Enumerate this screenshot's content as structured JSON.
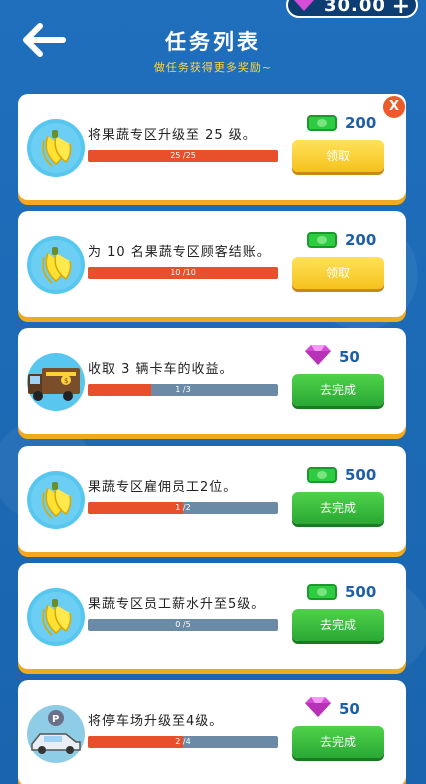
{
  "header": {
    "gem_value": "30.00",
    "plus_label": "+",
    "title": "任务列表",
    "subtitle": "做任务获得更多奖励~"
  },
  "close_label": "X",
  "colors": {
    "background": "#1a6ab8",
    "card": "#ffffff",
    "card_shadow": "#f1a91f",
    "progress_fill": "#e8502b",
    "progress_track": "#6b8aa5",
    "claim_button": "#f5c21b",
    "go_button": "#2aa834",
    "reward_text": "#1f5fa8"
  },
  "tasks": [
    {
      "icon": "banana-icon",
      "desc": "将果蔬专区升级至 25 级。",
      "progress_text": "25 /25",
      "progress": 1.0,
      "reward_icon": "cash-icon",
      "reward": "200",
      "button": "领取"
    },
    {
      "icon": "banana-icon",
      "desc": "为 10 名果蔬专区顾客结账。",
      "progress_text": "10 /10",
      "progress": 1.0,
      "reward_icon": "cash-icon",
      "reward": "200",
      "button": "领取"
    },
    {
      "icon": "truck-icon",
      "desc": "收取 3 辆卡车的收益。",
      "progress_text": "1 /3",
      "progress": 0.333,
      "reward_icon": "gem-icon",
      "reward": "50",
      "button": "去完成"
    },
    {
      "icon": "banana-icon",
      "desc": "果蔬专区雇佣员工2位。",
      "progress_text": "1 /2",
      "progress": 0.5,
      "reward_icon": "cash-icon",
      "reward": "500",
      "button": "去完成"
    },
    {
      "icon": "banana-icon",
      "desc": "果蔬专区员工薪水升至5级。",
      "progress_text": "0 /5",
      "progress": 0.0,
      "reward_icon": "cash-icon",
      "reward": "500",
      "button": "去完成"
    },
    {
      "icon": "parking-icon",
      "desc": "将停车场升级至4级。",
      "progress_text": "2 /4",
      "progress": 0.5,
      "reward_icon": "gem-icon",
      "reward": "50",
      "button": "去完成"
    }
  ]
}
